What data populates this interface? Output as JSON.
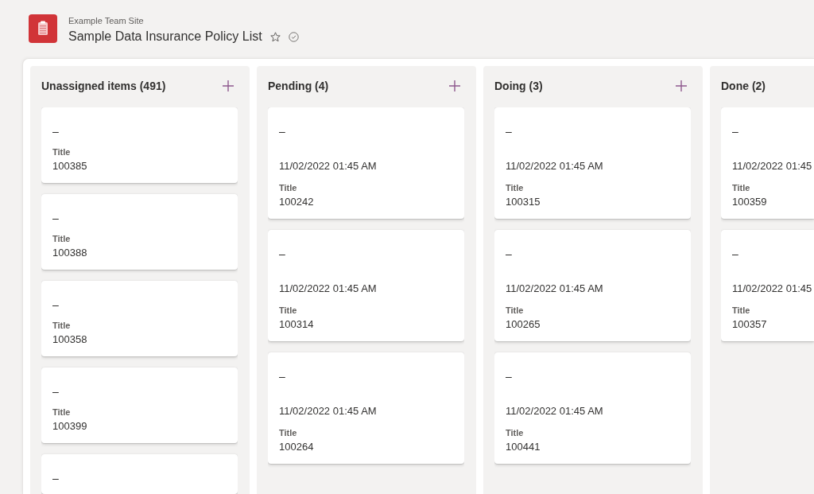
{
  "site": {
    "name": "Example Team Site",
    "title": "Sample Data Insurance Policy List"
  },
  "board": {
    "columns": [
      {
        "title": "Unassigned items (491)",
        "add_button": true,
        "cards": [
          {
            "heading": "–",
            "field_label": "Title",
            "field_value": "100385"
          },
          {
            "heading": "–",
            "field_label": "Title",
            "field_value": "100388"
          },
          {
            "heading": "–",
            "field_label": "Title",
            "field_value": "100358"
          },
          {
            "heading": "–",
            "field_label": "Title",
            "field_value": "100399"
          },
          {
            "heading": "–"
          }
        ]
      },
      {
        "title": "Pending (4)",
        "add_button": true,
        "cards": [
          {
            "heading": "–",
            "date": "11/02/2022 01:45 AM",
            "field_label": "Title",
            "field_value": "100242"
          },
          {
            "heading": "–",
            "date": "11/02/2022 01:45 AM",
            "field_label": "Title",
            "field_value": "100314"
          },
          {
            "heading": "–",
            "date": "11/02/2022 01:45 AM",
            "field_label": "Title",
            "field_value": "100264"
          }
        ]
      },
      {
        "title": "Doing (3)",
        "add_button": true,
        "cards": [
          {
            "heading": "–",
            "date": "11/02/2022 01:45 AM",
            "field_label": "Title",
            "field_value": "100315"
          },
          {
            "heading": "–",
            "date": "11/02/2022 01:45 AM",
            "field_label": "Title",
            "field_value": "100265"
          },
          {
            "heading": "–",
            "date": "11/02/2022 01:45 AM",
            "field_label": "Title",
            "field_value": "100441"
          }
        ]
      },
      {
        "title": "Done (2)",
        "add_button": false,
        "cards": [
          {
            "heading": "–",
            "date": "11/02/2022 01:45",
            "field_label": "Title",
            "field_value": "100359"
          },
          {
            "heading": "–",
            "date": "11/02/2022 01:45",
            "field_label": "Title",
            "field_value": "100357"
          }
        ]
      }
    ]
  }
}
